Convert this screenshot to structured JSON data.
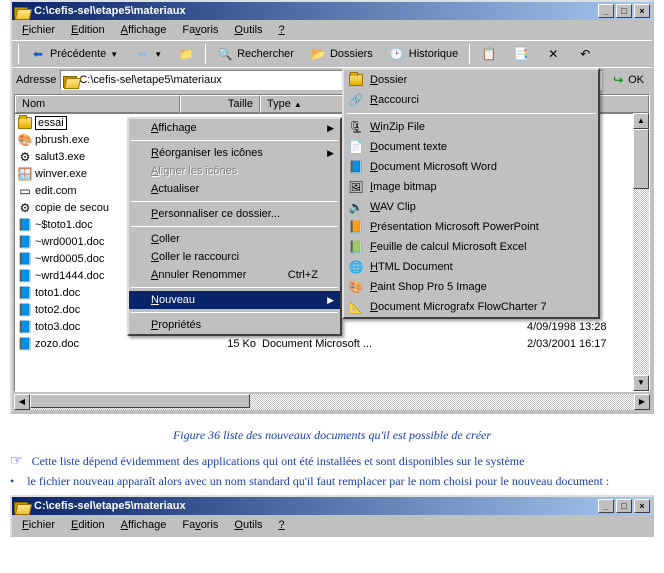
{
  "window1": {
    "title": "C:\\cefis-sel\\etape5\\materiaux",
    "menus": [
      "Fichier",
      "Edition",
      "Affichage",
      "Favoris",
      "Outils",
      "?"
    ],
    "toolbar": {
      "back": "Précédente",
      "search": "Rechercher",
      "folders": "Dossiers",
      "history": "Historique"
    },
    "address_label": "Adresse",
    "address_value": "C:\\cefis-sel\\etape5\\materiaux",
    "ok_label": "OK",
    "columns": {
      "name": "Nom",
      "size": "Taille",
      "type": "Type",
      "date": ""
    },
    "files": [
      {
        "icon": "folder",
        "name": "essai",
        "size": "",
        "type": "",
        "date": "",
        "editing": true
      },
      {
        "icon": "paint",
        "name": "pbrush.exe",
        "size": "",
        "type": "",
        "date": ""
      },
      {
        "icon": "app",
        "name": "salut3.exe",
        "size": "",
        "type": "",
        "date": ""
      },
      {
        "icon": "winver",
        "name": "winver.exe",
        "size": "",
        "type": "",
        "date": ""
      },
      {
        "icon": "msdos",
        "name": "edit.com",
        "size": "",
        "type": "",
        "date": ""
      },
      {
        "icon": "bat",
        "name": "copie de secou",
        "size": "",
        "type": "",
        "date": ""
      },
      {
        "icon": "word",
        "name": "~$toto1.doc",
        "size": "",
        "type": "",
        "date": ""
      },
      {
        "icon": "word",
        "name": "~wrd0001.doc",
        "size": "",
        "type": "",
        "date": ""
      },
      {
        "icon": "word",
        "name": "~wrd0005.doc",
        "size": "",
        "type": "",
        "date": ""
      },
      {
        "icon": "word",
        "name": "~wrd1444.doc",
        "size": "",
        "type": "",
        "date": ""
      },
      {
        "icon": "word",
        "name": "toto1.doc",
        "size": "",
        "type": "",
        "date": ""
      },
      {
        "icon": "word",
        "name": "toto2.doc",
        "size": "",
        "type": "",
        "date": ""
      },
      {
        "icon": "word",
        "name": "toto3.doc",
        "size": "",
        "type": "osoft ...",
        "date": "4/09/1998 13:28"
      },
      {
        "icon": "word",
        "name": "zozo.doc",
        "size": "15 Ko",
        "type": "Document Microsoft ...",
        "date": "2/03/2001 16:17"
      }
    ]
  },
  "context_menu": {
    "items": [
      {
        "label": "Affichage",
        "arrow": true
      },
      {
        "sep": true
      },
      {
        "label": "Réorganiser les icônes",
        "arrow": true
      },
      {
        "label": "Aligner les icônes",
        "disabled": true
      },
      {
        "label": "Actualiser"
      },
      {
        "sep": true
      },
      {
        "label": "Personnaliser ce dossier..."
      },
      {
        "sep": true
      },
      {
        "label": "Coller"
      },
      {
        "label": "Coller le raccourci"
      },
      {
        "label": "Annuler Renommer",
        "shortcut": "Ctrl+Z"
      },
      {
        "sep": true
      },
      {
        "label": "Nouveau",
        "arrow": true,
        "highlight": true
      },
      {
        "sep": true
      },
      {
        "label": "Propriétés"
      }
    ]
  },
  "new_submenu": {
    "items": [
      {
        "icon": "folder",
        "label": "Dossier"
      },
      {
        "icon": "shortcut",
        "label": "Raccourci"
      },
      {
        "sep": true
      },
      {
        "icon": "winzip",
        "label": "WinZip File"
      },
      {
        "icon": "txt",
        "label": "Document texte"
      },
      {
        "icon": "word",
        "label": "Document Microsoft Word"
      },
      {
        "icon": "bmp",
        "label": "Image bitmap"
      },
      {
        "icon": "wav",
        "label": "WAV Clip"
      },
      {
        "icon": "ppt",
        "label": "Présentation Microsoft PowerPoint"
      },
      {
        "icon": "xls",
        "label": "Feuille de calcul Microsoft Excel"
      },
      {
        "icon": "html",
        "label": "HTML Document"
      },
      {
        "icon": "psp",
        "label": "Paint Shop Pro 5 Image"
      },
      {
        "icon": "flow",
        "label": "Document Micrografx FlowCharter 7"
      }
    ]
  },
  "caption": "Figure 36 liste des nouveaux documents qu'il est possible de créer",
  "note1": "Cette liste dépend évidemment des applications qui ont été installées et sont disponibles sur le système",
  "note2": "le fichier nouveau apparaît alors avec un nom standard qu'il faut remplacer par le nom choisi pour le nouveau document :",
  "window2": {
    "title": "C:\\cefis-sel\\etape5\\materiaux",
    "menus": [
      "Fichier",
      "Edition",
      "Affichage",
      "Favoris",
      "Outils",
      "?"
    ]
  },
  "icon_glyphs": {
    "folder": "📁",
    "shortcut": "🔗",
    "winzip": "🗜",
    "txt": "📄",
    "word": "📘",
    "bmp": "🖼",
    "wav": "🔊",
    "ppt": "📙",
    "xls": "📗",
    "html": "🌐",
    "psp": "🎨",
    "flow": "📐",
    "paint": "🎨",
    "app": "⚙",
    "winver": "🪟",
    "msdos": "▭",
    "bat": "⚙"
  }
}
